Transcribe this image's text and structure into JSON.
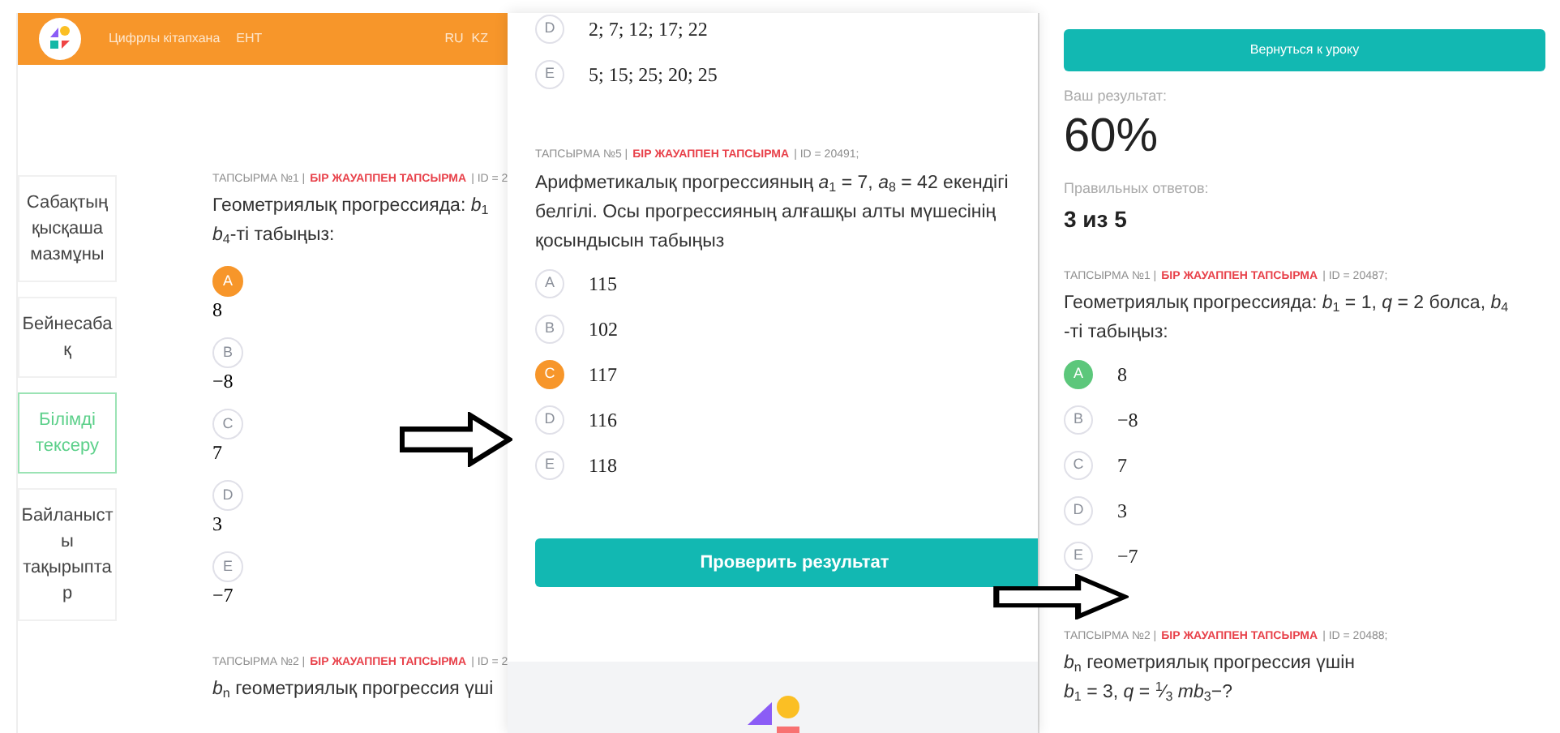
{
  "panels": [
    {
      "kind": "lesson",
      "header": {
        "nav": [
          "Цифрлы кітапхана",
          "ЕНТ"
        ],
        "langs": [
          "RU",
          "KZ"
        ]
      },
      "sidebar": [
        {
          "label": "Сабақтың қысқаша мазмұны",
          "selected": false
        },
        {
          "label": "Бейнесабақ",
          "selected": false
        },
        {
          "label": "Білімді тексеру",
          "selected": true
        },
        {
          "label": "Байланысты тақырыптар",
          "selected": false
        }
      ],
      "questions": [
        {
          "number": "ТАПСЫРМА №1 |",
          "type": "БІР ЖАУАППЕН ТАПСЫРМА",
          "id": "| ID = 2",
          "lines": [
            "Геометриялық прогрессияда: *b*$_{1}$",
            "*b*$_{4}$-ті табыңыз:"
          ],
          "graded": false,
          "options": [
            {
              "letter": "A",
              "value": "8",
              "selected": true
            },
            {
              "letter": "B",
              "value": "−8",
              "selected": false
            },
            {
              "letter": "C",
              "value": "7",
              "selected": false
            },
            {
              "letter": "D",
              "value": "3",
              "selected": false
            },
            {
              "letter": "E",
              "value": "−7",
              "selected": false
            }
          ]
        },
        {
          "number": "ТАПСЫРМА №2 |",
          "type": "БІР ЖАУАППЕН ТАПСЫРМА",
          "id": "| ID = 2",
          "lines": [
            "*b*$_{n}$ геометриялық прогрессия үші"
          ]
        }
      ]
    },
    {
      "kind": "quiz",
      "questions": [
        {
          "options": [
            {
              "letter": "D",
              "value": "2; 7; 12; 17; 22",
              "selected": false
            },
            {
              "letter": "E",
              "value": "5; 15; 25; 20; 25",
              "selected": false
            }
          ]
        },
        {
          "number": "ТАПСЫРМА №5 |",
          "type": "БІР ЖАУАППЕН ТАПСЫРМА",
          "id": "| ID = 20491;",
          "lines": [
            "Арифметикалық прогрессияның *a*$_{1}$ = 7, *a*$_{8}$ = 42 екендігі",
            "белгілі. Осы прогрессияның алғашқы алты мүшесінің",
            "қосындысын табыңыз"
          ],
          "graded": false,
          "options": [
            {
              "letter": "A",
              "value": "115",
              "selected": false
            },
            {
              "letter": "B",
              "value": "102",
              "selected": false
            },
            {
              "letter": "C",
              "value": "117",
              "selected": true
            },
            {
              "letter": "D",
              "value": "116",
              "selected": false
            },
            {
              "letter": "E",
              "value": "118",
              "selected": false
            }
          ]
        }
      ],
      "button": "Проверить результат"
    },
    {
      "kind": "result",
      "button": "Вернуться к уроку",
      "result_label": "Ваш результат:",
      "result_value": "60%",
      "correct_label": "Правильных ответов:",
      "correct_value": "3 из 5",
      "questions": [
        {
          "number": "ТАПСЫРМА №1 |",
          "type": "БІР ЖАУАППЕН ТАПСЫРМА",
          "id": "| ID = 20487;",
          "lines": [
            "Геометриялық прогрессияда: *b*$_{1}$ = 1, *q* = 2 болса, *b*$_{4}$",
            "-ті табыңыз:"
          ],
          "graded": true,
          "options": [
            {
              "letter": "A",
              "value": "8",
              "selected": true
            },
            {
              "letter": "B",
              "value": "−8",
              "selected": false
            },
            {
              "letter": "C",
              "value": "7",
              "selected": false
            },
            {
              "letter": "D",
              "value": "3",
              "selected": false
            },
            {
              "letter": "E",
              "value": "−7",
              "selected": false
            }
          ]
        },
        {
          "number": "ТАПСЫРМА №2 |",
          "type": "БІР ЖАУАППЕН ТАПСЫРМА",
          "id": "| ID = 20488;",
          "lines": [
            "*b*$_{n}$ геометриялық прогрессия үшін",
            "*b*$_{1}$ = 3, *q* = $^{1}$⁄$_{3}$ *mb*$_{3}$−?"
          ]
        }
      ]
    }
  ]
}
